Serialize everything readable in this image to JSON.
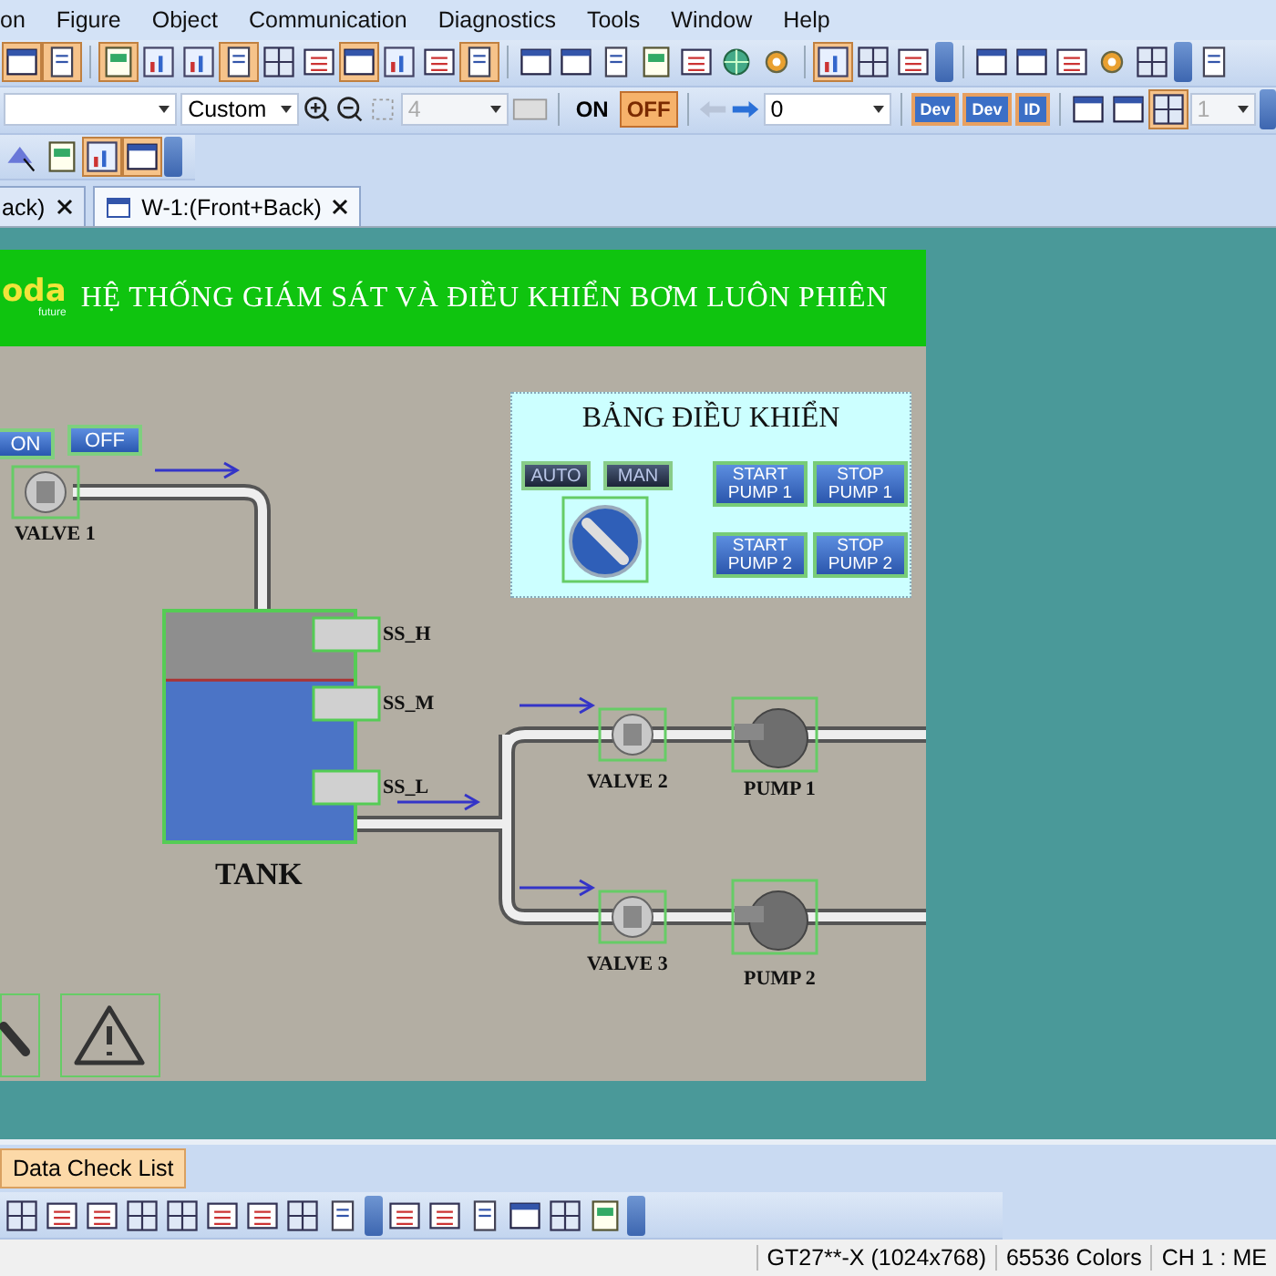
{
  "menu": [
    "on",
    "Figure",
    "Object",
    "Communication",
    "Diagnostics",
    "Tools",
    "Window",
    "Help"
  ],
  "toolbar": {
    "combos": [
      {
        "value": "Custom",
        "disabled": false
      },
      {
        "value": "4",
        "disabled": true
      },
      {
        "value": "0",
        "disabled": false
      },
      {
        "value": "1",
        "disabled": true
      }
    ],
    "toggle": [
      {
        "label": "ON",
        "selected": false
      },
      {
        "label": "OFF",
        "selected": true
      }
    ],
    "device_buttons": [
      {
        "label": "Dev",
        "selected": false
      },
      {
        "label": "Dev",
        "selected": false
      },
      {
        "label": "ID",
        "selected": false
      }
    ]
  },
  "tabs": [
    {
      "label": "ack)",
      "selected": false
    },
    {
      "label": "W-1:(Front+Back)",
      "selected": true
    }
  ],
  "screen": {
    "logo": "oda",
    "logo_tagline": "future",
    "title": "HỆ THỐNG GIÁM SÁT VÀ ĐIỀU KHIỂN BƠM LUÔN PHIÊN",
    "valve1_buttons": [
      {
        "label": "ON"
      },
      {
        "label": "OFF"
      }
    ],
    "panel": {
      "title": "BẢNG ĐIỀU KHIỂN",
      "mode_buttons": [
        {
          "label": "AUTO"
        },
        {
          "label": "MAN"
        }
      ],
      "pump_buttons": [
        {
          "label": "START PUMP 1"
        },
        {
          "label": "STOP PUMP 1"
        },
        {
          "label": "START PUMP 2"
        },
        {
          "label": "STOP PUMP 2"
        }
      ]
    },
    "tank": {
      "label": "TANK",
      "level": 0.7
    },
    "sensors": [
      {
        "label": "SS_H"
      },
      {
        "label": "SS_M"
      },
      {
        "label": "SS_L"
      }
    ],
    "valves": [
      {
        "label": "VALVE 1"
      },
      {
        "label": "VALVE 2"
      },
      {
        "label": "VALVE 3"
      }
    ],
    "pumps": [
      {
        "label": "PUMP 1"
      },
      {
        "label": "PUMP 2"
      }
    ]
  },
  "bottom_tab": {
    "label": "Data Check List"
  },
  "status_bar": [
    "GT27**-X (1024x768)",
    "65536 Colors",
    "CH 1 : ME"
  ]
}
